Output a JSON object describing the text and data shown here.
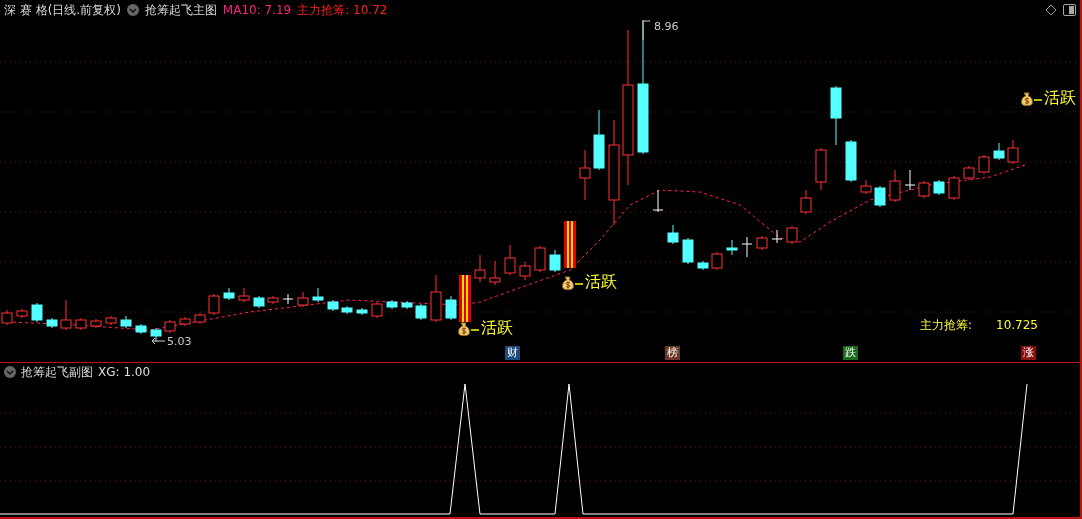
{
  "header": {
    "title": "深 赛 格(日线.前复权)",
    "indicator": "抢筹起飞主图",
    "ma": "MA10: 7.19",
    "main_force": "主力抢筹: 10.72"
  },
  "main_chart": {
    "high_label": "8.96",
    "low_label": "5.03",
    "signals": [
      {
        "text": "活跃"
      },
      {
        "text": "活跃"
      },
      {
        "text": "活跃"
      }
    ],
    "readout": {
      "label": "主力抢筹:",
      "value": "10.725"
    }
  },
  "badges": [
    {
      "text": "财",
      "color": "#1e4a7a"
    },
    {
      "text": "榜",
      "color": "#6a3a28"
    },
    {
      "text": "跌",
      "color": "#1a6a1a"
    },
    {
      "text": "涨",
      "color": "#8a1010"
    }
  ],
  "sub_chart": {
    "title": "抢筹起飞副图",
    "reading": "XG: 1.00"
  }
}
